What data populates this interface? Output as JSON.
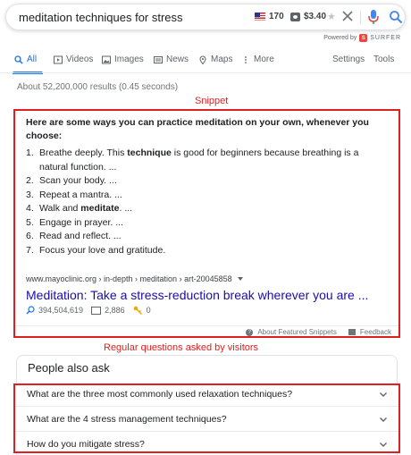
{
  "search": {
    "query": "meditation techniques for stress",
    "keyword_volume": "170",
    "keyword_cpc": "$3.40"
  },
  "surfer": {
    "powered_by": "Powered by",
    "brand": "SURFER",
    "logo_letter": "S"
  },
  "tabs": {
    "all": "All",
    "videos": "Videos",
    "images": "Images",
    "news": "News",
    "maps": "Maps",
    "more": "More",
    "settings": "Settings",
    "tools": "Tools"
  },
  "result_stats": "About 52,200,000 results (0.45 seconds)",
  "annotations": {
    "snippet": "Snippet",
    "questions": "Regular questions asked by visitors"
  },
  "snippet": {
    "heading": "Here are some ways you can practice meditation on your own, whenever you choose:",
    "items": [
      {
        "n": "1.",
        "pre": "Breathe deeply. This ",
        "bold": "technique",
        "post": " is good for beginners because breathing is a natural function. ..."
      },
      {
        "n": "2.",
        "pre": "Scan your body. ...",
        "bold": "",
        "post": ""
      },
      {
        "n": "3.",
        "pre": "Repeat a mantra. ...",
        "bold": "",
        "post": ""
      },
      {
        "n": "4.",
        "pre": "Walk and ",
        "bold": "meditate",
        "post": ". ..."
      },
      {
        "n": "5.",
        "pre": "Engage in prayer. ...",
        "bold": "",
        "post": ""
      },
      {
        "n": "6.",
        "pre": "Read and reflect. ...",
        "bold": "",
        "post": ""
      },
      {
        "n": "7.",
        "pre": "Focus your love and gratitude.",
        "bold": "",
        "post": ""
      }
    ],
    "url": "www.mayoclinic.org › in-depth › meditation › art-20045858",
    "title": "Meditation: Take a stress-reduction break wherever you are ...",
    "metrics": {
      "keywords": "394,504,619",
      "words": "2,886",
      "links": "0"
    },
    "footer": {
      "about": "About Featured Snippets",
      "feedback": "Feedback"
    }
  },
  "people_also_ask": {
    "title": "People also ask",
    "questions": [
      "What are the three most commonly used relaxation techniques?",
      "What are the 4 stress management techniques?",
      "How do you mitigate stress?"
    ]
  },
  "colors": {
    "accent_blue": "#1a73e8",
    "link": "#1a0dab",
    "annotation_red": "#e02020",
    "mic_red": "#ea4335"
  }
}
